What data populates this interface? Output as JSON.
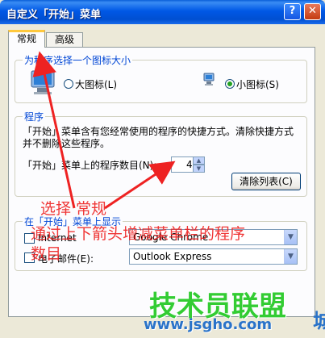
{
  "window": {
    "title": "自定义「开始」菜单",
    "help_glyph": "?",
    "close_glyph": "✕"
  },
  "tabs": [
    {
      "label": "常规",
      "active": true
    },
    {
      "label": "高级",
      "active": false
    }
  ],
  "icon_size_group": {
    "title": "为程序选择一个图标大小",
    "large_label": "大图标(L)",
    "small_label": "小图标(S)",
    "selected": "small"
  },
  "programs_group": {
    "title": "程序",
    "description_line1": "「开始」菜单含有您经常使用的程序的快捷方式。清除快捷方式",
    "description_line2": "并不删除这些程序。",
    "count_label": "「开始」菜单上的程序数目(N):",
    "count_value": "4",
    "clear_button": "清除列表(C)"
  },
  "show_group": {
    "title": "在「开始」菜单上显示",
    "internet_label": "Internet",
    "internet_value": "Google Chrome",
    "email_label": "电子邮件(E):",
    "email_value": "Outlook Express"
  },
  "annotations": {
    "line1": "选择 常规",
    "line2": "通过上下箭头增减菜单栏的程序",
    "line3": "数目"
  },
  "watermark": {
    "brand": "技术员联盟",
    "url": "www.jsgho.com",
    "logo_fragment": "城"
  },
  "colors": {
    "titlebar": "#0058e6",
    "group_title": "#0046d5",
    "annotation": "#ee2222",
    "watermark_green": "#33cc33",
    "watermark_blue": "#2a73c9"
  }
}
